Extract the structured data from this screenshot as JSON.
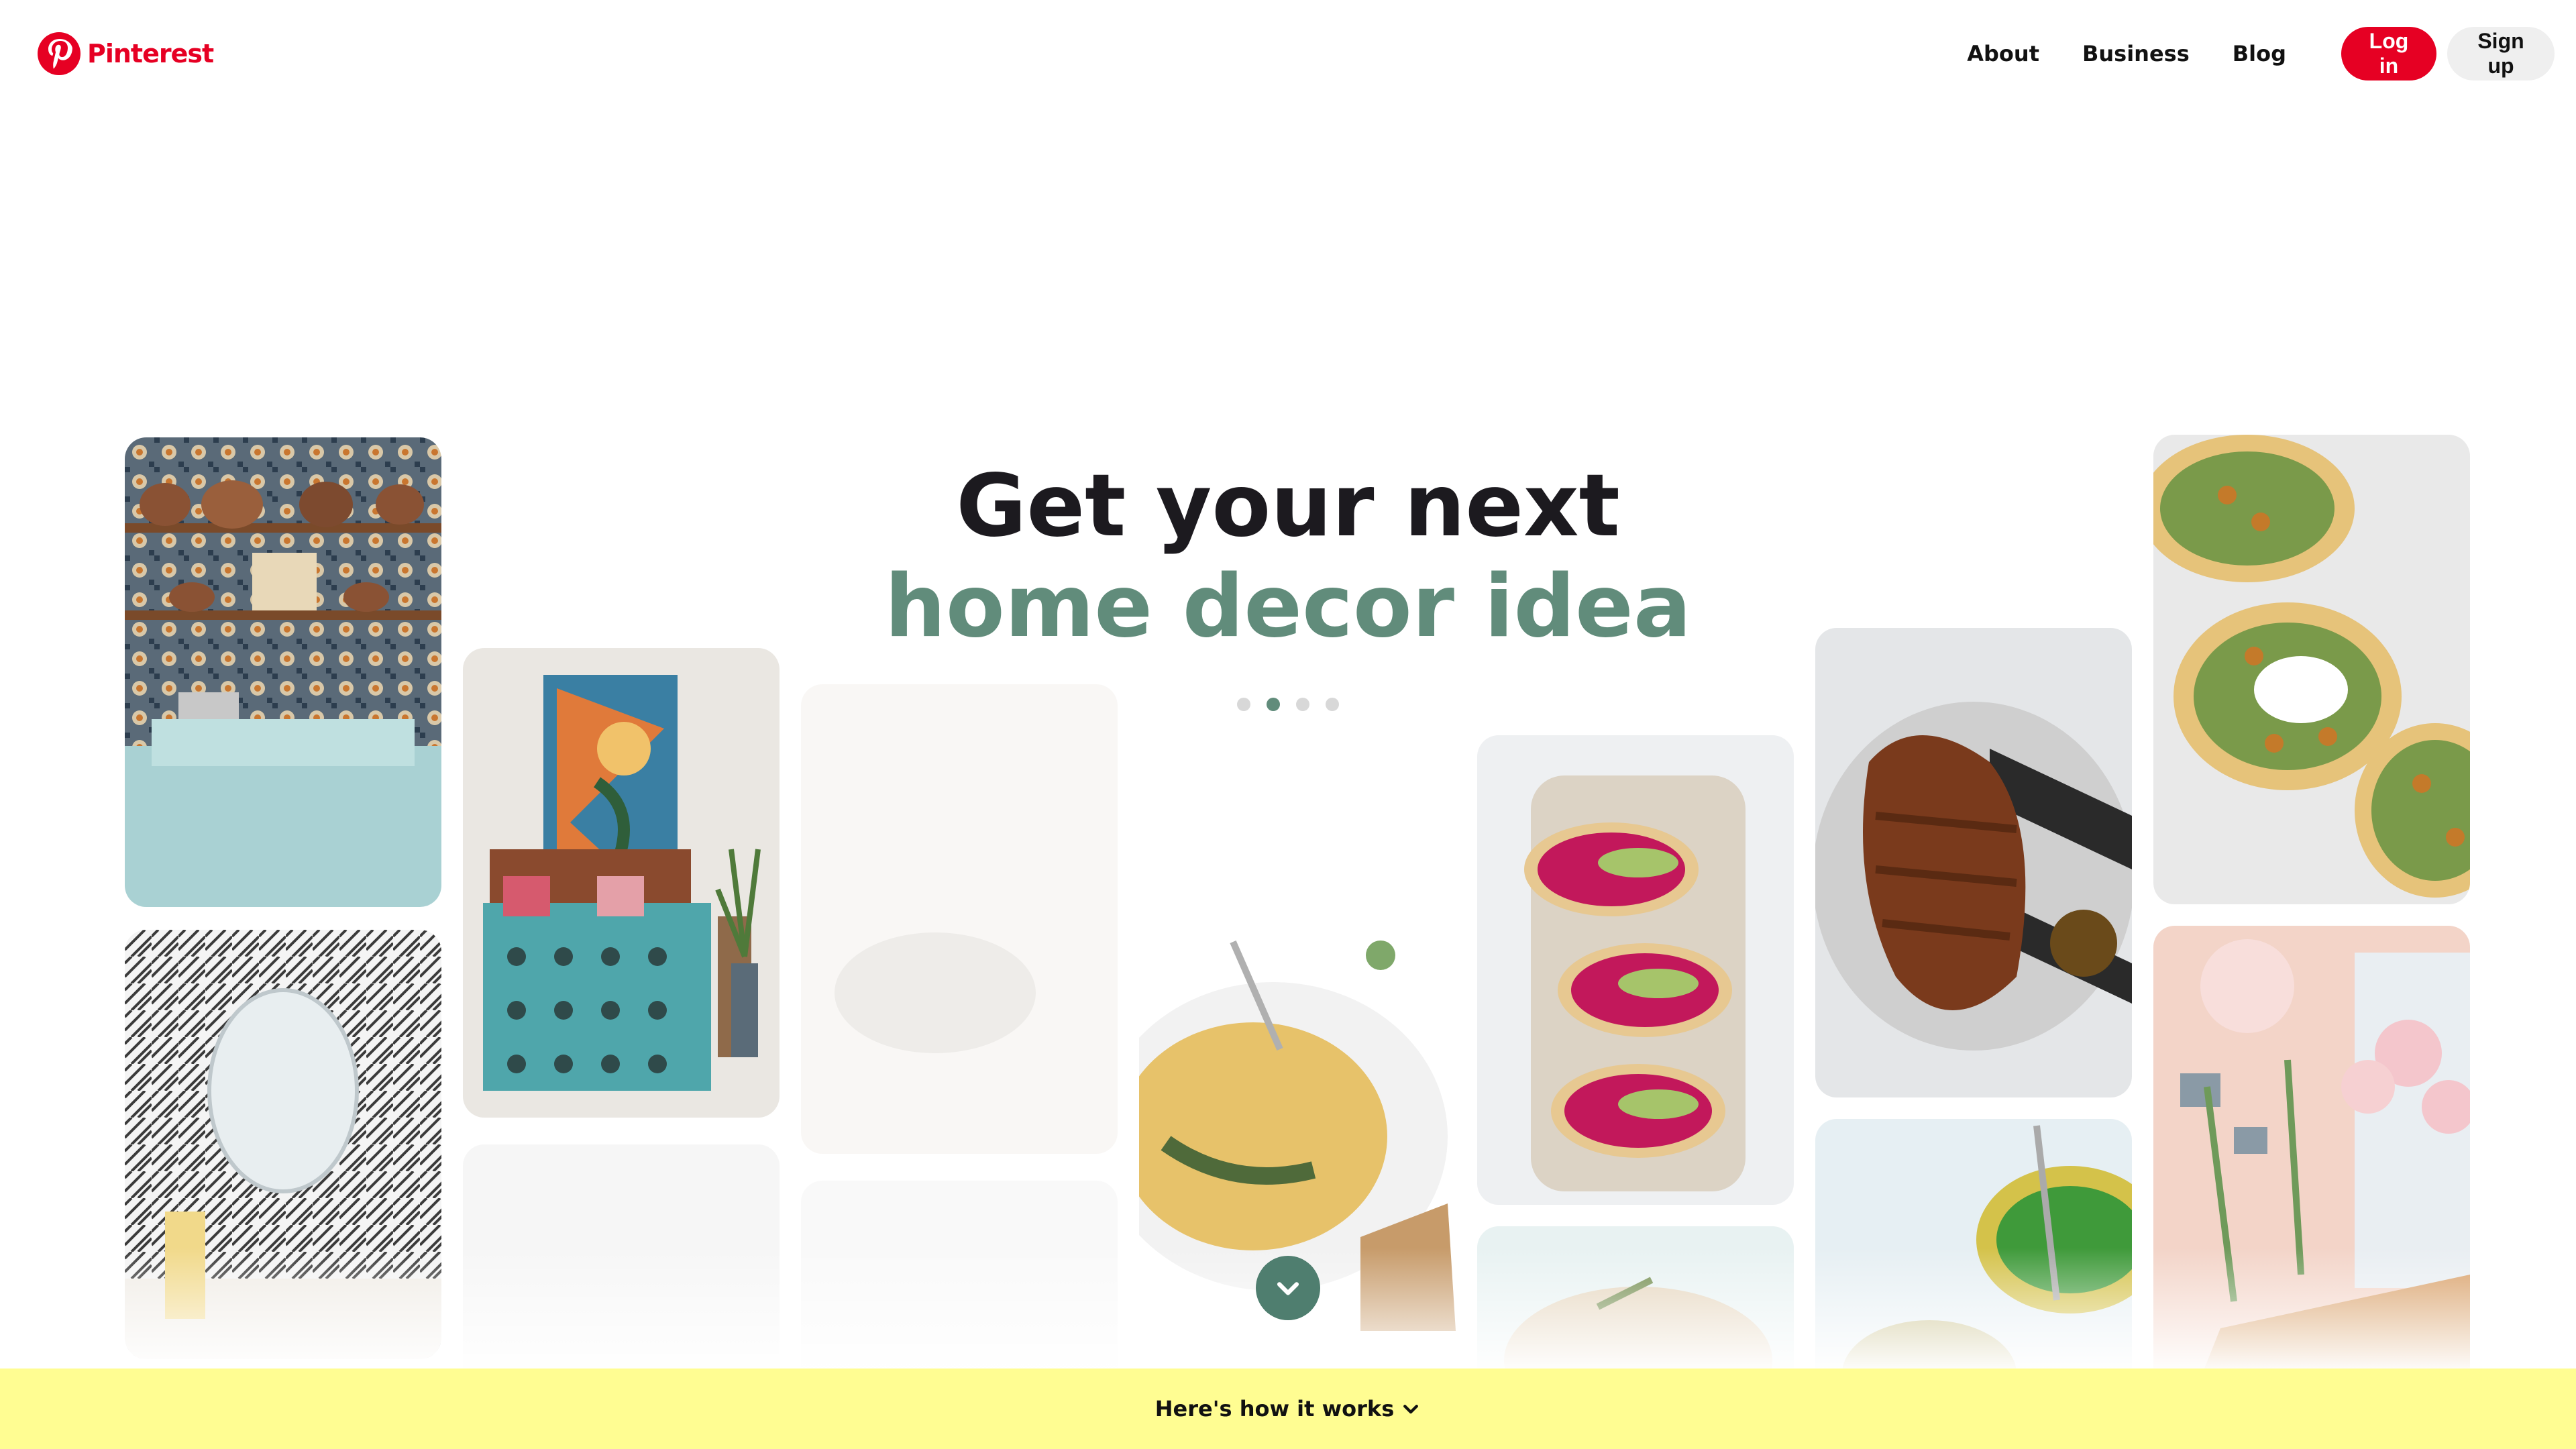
{
  "header": {
    "brand_name": "Pinterest",
    "nav": [
      {
        "label": "About"
      },
      {
        "label": "Business"
      },
      {
        "label": "Blog"
      }
    ],
    "login_label": "Log in",
    "signup_label": "Sign up"
  },
  "hero": {
    "line1": "Get your next",
    "line2": "home decor idea",
    "dots_count": 4,
    "active_dot": 2
  },
  "tiles": [
    {
      "name": "kitchen-tile-shelves-image",
      "faded": false
    },
    {
      "name": "patterned-bathroom-image",
      "faded": false
    },
    {
      "name": "bedroom-painting-image",
      "faded": false
    },
    {
      "name": "faded-pin-image",
      "faded": true
    },
    {
      "name": "faded-cooking-image",
      "faded": true
    },
    {
      "name": "faded-pin-image-2",
      "faded": true
    },
    {
      "name": "hummus-bowl-image",
      "faded": false
    },
    {
      "name": "beet-avocado-toast-image",
      "faded": false
    },
    {
      "name": "flatbread-image",
      "faded": false
    },
    {
      "name": "grilled-chicken-image",
      "faded": false
    },
    {
      "name": "peas-bowl-image",
      "faded": false
    },
    {
      "name": "chickpea-flatbread-image",
      "faded": false
    },
    {
      "name": "pink-party-room-image",
      "faded": false
    }
  ],
  "how_it_works": {
    "label": "Here's how it works"
  },
  "colors": {
    "brand": "#e60023",
    "hero_accent": "#618c7b",
    "scroll_button": "#4f7e6f",
    "bottom_bar": "#fffd92"
  },
  "icons": {
    "brand": "pinterest-logo-icon",
    "scroll": "chevron-down-icon",
    "how": "chevron-down-icon"
  }
}
